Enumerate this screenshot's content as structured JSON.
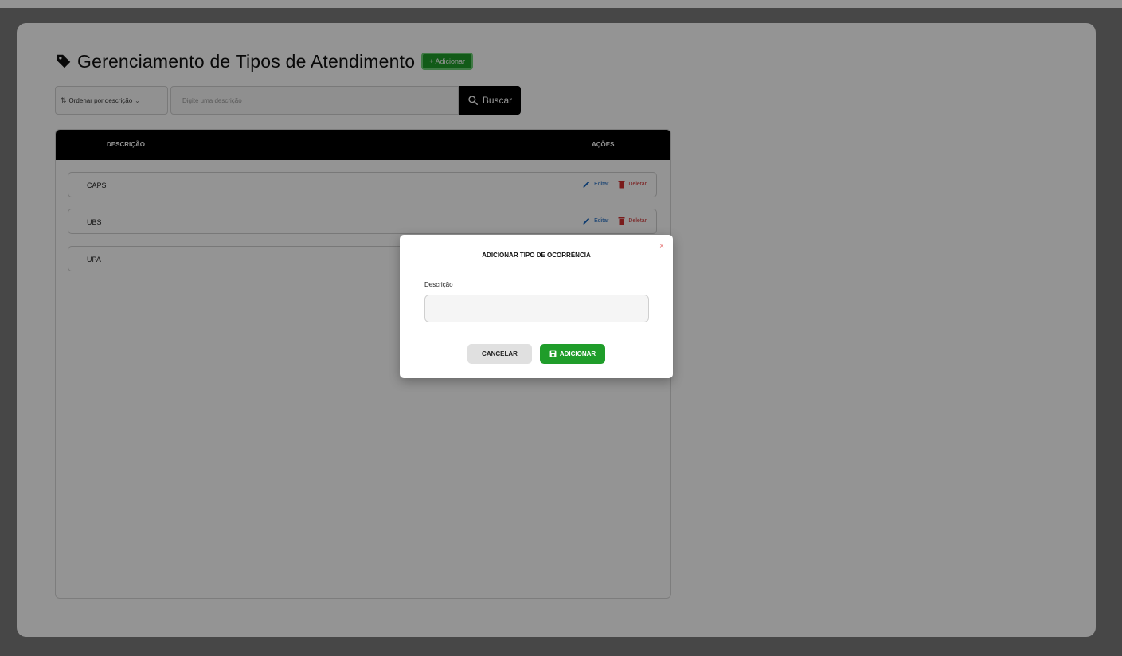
{
  "header": {
    "title": "Gerenciamento de Tipos de Atendimento",
    "add_label": "+ Adicionar"
  },
  "search": {
    "sort_label": "Ordenar por descrição",
    "placeholder": "Digite uma descrição",
    "button_label": "Buscar"
  },
  "table": {
    "columns": [
      "DESCRIÇÃO",
      "AÇÕES"
    ],
    "rows": [
      {
        "descricao": "CAPS"
      },
      {
        "descricao": "UBS"
      },
      {
        "descricao": "UPA"
      }
    ],
    "edit_label": "Editar",
    "delete_label": "Deletar"
  },
  "modal": {
    "title": "ADICIONAR TIPO DE OCORRÊNCIA",
    "close": "×",
    "field_label": "Descrição",
    "field_value": "",
    "cancel_label": "CANCELAR",
    "add_label": "ADICIONAR"
  },
  "colors": {
    "accent_green": "#1f9d2a",
    "header_black": "#000000",
    "edit_blue": "#1565c0",
    "delete_red": "#d32f2f"
  }
}
